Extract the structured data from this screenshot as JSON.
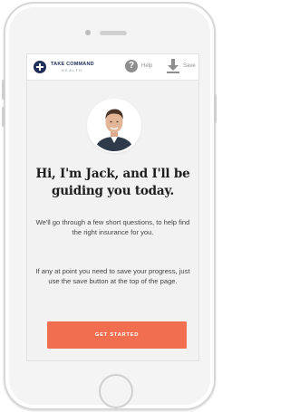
{
  "header": {
    "logo_line1": "TAKE COMMAND",
    "logo_line2": "HEALTH",
    "logo_icon": "plus-circle-icon",
    "help_label": "Help",
    "help_icon": "question-circle-icon",
    "save_label": "Save",
    "save_icon": "download-icon"
  },
  "main": {
    "avatar_alt": "Jack",
    "headline": "Hi, I'm Jack, and I'll be guiding you today.",
    "intro": "We'll go through a few short questions, to help find the right insurance for you.",
    "save_note": "If any at point you need to save your progress, just use the save button at the top of the page.",
    "cta_label": "GET STARTED"
  },
  "colors": {
    "brand_navy": "#21315b",
    "cta_orange": "#f26e50",
    "background": "#f2f2f2",
    "icon_gray": "#8e8e8e"
  }
}
